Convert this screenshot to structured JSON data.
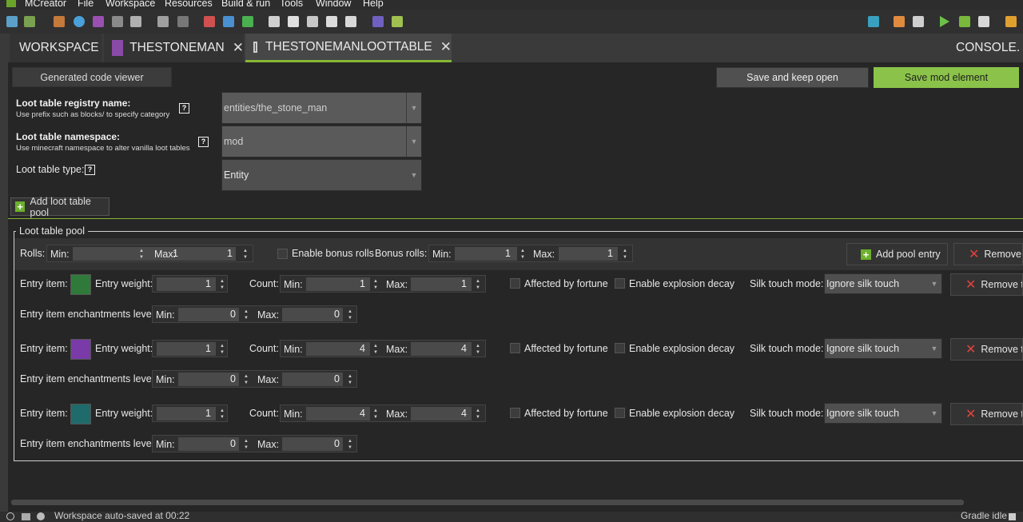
{
  "menu": [
    "MCreator",
    "File",
    "Workspace",
    "Resources",
    "Build & run",
    "Tools",
    "Window",
    "Help"
  ],
  "tabs": {
    "workspace": "WORKSPACE",
    "mob": "THESTONEMAN",
    "loot": "THESTONEMANLOOTTABLE",
    "console": "CONSOLE"
  },
  "top": {
    "code_viewer": "Generated code viewer",
    "save_keep_open": "Save and keep open",
    "save_mod": "Save mod element"
  },
  "registry": {
    "label": "Loot table registry name:",
    "hint": "Use prefix such as blocks/ to specify category",
    "value": "entities/the_stone_man"
  },
  "namespace": {
    "label": "Loot table namespace:",
    "hint": "Use minecraft namespace to alter vanilla loot tables",
    "value": "mod"
  },
  "type": {
    "label": "Loot table type:",
    "value": "Entity"
  },
  "add_pool": "Add loot table pool",
  "pool": {
    "title": "Loot table pool",
    "rolls": "Rolls:",
    "min": "Min:",
    "max": "Max:",
    "rolls_min": "1",
    "rolls_max": "1",
    "bonus_enable": "Enable bonus rolls",
    "bonus_rolls": "Bonus rolls:",
    "bonus_min": "1",
    "bonus_max": "1",
    "add_entry": "Add pool entry",
    "remove": "Remove"
  },
  "entry_labels": {
    "item": "Entry item:",
    "weight": "Entry weight:",
    "count": "Count:",
    "fortune": "Affected by fortune",
    "explosion": "Enable explosion decay",
    "silk": "Silk touch mode:",
    "remove": "Remove t",
    "enchant": "Entry item enchantments level:"
  },
  "entries": [
    {
      "icon": "emerald-icon",
      "weight": "1",
      "count_min": "1",
      "count_max": "1",
      "silk": "Ignore silk touch",
      "ench_min": "0",
      "ench_max": "0"
    },
    {
      "icon": "amethyst-shard-icon",
      "weight": "1",
      "count_min": "4",
      "count_max": "4",
      "silk": "Ignore silk touch",
      "ench_min": "0",
      "ench_max": "0"
    },
    {
      "icon": "ender-eye-icon",
      "weight": "1",
      "count_min": "4",
      "count_max": "4",
      "silk": "Ignore silk touch",
      "ench_min": "0",
      "ench_max": "0"
    }
  ],
  "status": {
    "text": "Workspace auto-saved at 00:22",
    "gradle": "Gradle idle"
  },
  "colors": {
    "accent": "#86b735",
    "save_button": "#8bc34a",
    "remove_icon": "#e5413d"
  }
}
